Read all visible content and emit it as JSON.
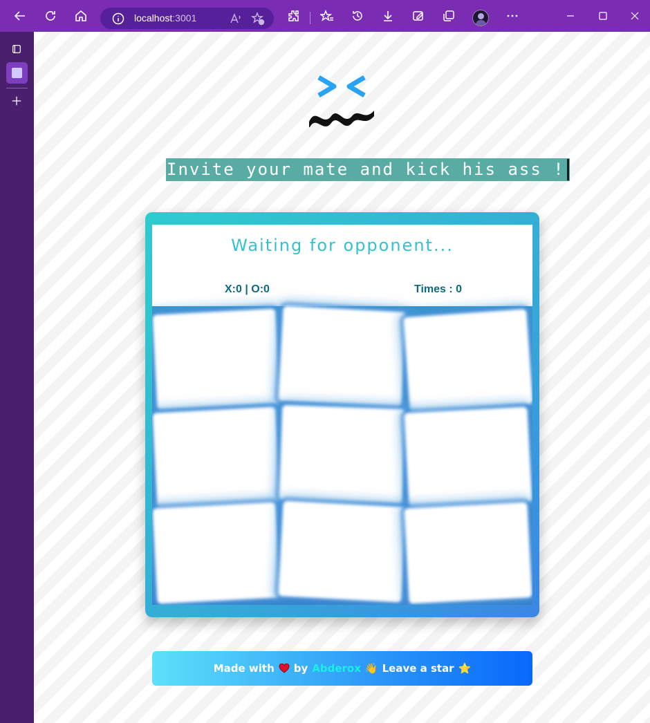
{
  "browser": {
    "url_host": "localhost",
    "url_port": ":3001",
    "toolbar_icons": [
      "back-icon",
      "refresh-icon",
      "home-icon",
      "info-icon",
      "read-aloud-icon",
      "add-favorite-icon",
      "extensions-icon",
      "favorites-icon",
      "history-icon",
      "downloads-icon",
      "screenshot-icon",
      "collections-icon",
      "profile-avatar",
      "more-icon"
    ],
    "window_controls": [
      "minimize-icon",
      "maximize-icon",
      "close-icon"
    ],
    "accent": "#7a2db3"
  },
  "sidebar": {
    "icons": [
      "tab-actions-icon",
      "active-tab-icon",
      "new-tab-icon"
    ],
    "background": "#491f6e"
  },
  "game": {
    "headline": "Invite your mate and kick his ass !",
    "status": "Waiting for opponent...",
    "score": "X:0 | O:0",
    "times": "Times : 0",
    "cells": [
      "",
      "",
      "",
      "",
      "",
      "",
      "",
      "",
      ""
    ]
  },
  "footer": {
    "made_with": "Made with",
    "by": "by",
    "author": "Abderox",
    "wave_emoji": "👋",
    "leave_star": "Leave a star",
    "star_emoji": "⭐"
  },
  "colors": {
    "headline_bg": "#58aca4",
    "status_text": "#33c3cc",
    "score_text": "#0d6b7d",
    "board_gradient_start": "#2fcccd",
    "board_gradient_end": "#3b86e3",
    "footer_gradient_start": "#5de0fb",
    "footer_gradient_end": "#0868fb",
    "author_color": "#19f0e5"
  }
}
